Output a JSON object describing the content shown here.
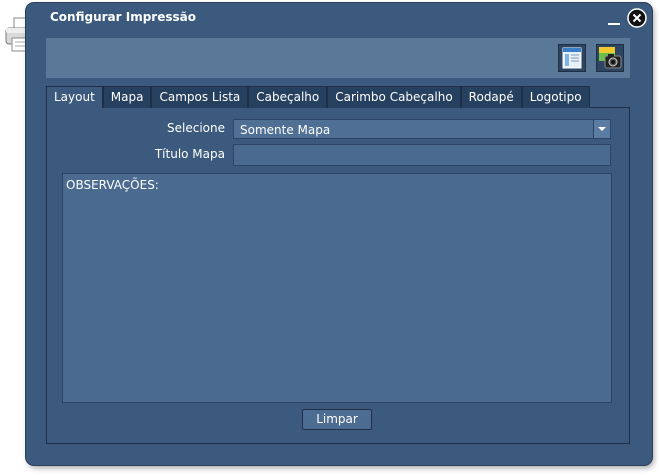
{
  "window": {
    "title": "Configurar Impressão"
  },
  "toolbar": {
    "buttons": [
      {
        "icon": "layout-preview-icon"
      },
      {
        "icon": "camera-snapshot-icon"
      }
    ]
  },
  "tabs": [
    {
      "label": "Layout",
      "active": true
    },
    {
      "label": "Mapa",
      "active": false
    },
    {
      "label": "Campos Lista",
      "active": false
    },
    {
      "label": "Cabeçalho",
      "active": false
    },
    {
      "label": "Carimbo Cabeçalho",
      "active": false
    },
    {
      "label": "Rodapé",
      "active": false
    },
    {
      "label": "Logotipo",
      "active": false
    }
  ],
  "form": {
    "selecione_label": "Selecione",
    "selecione_value": "Somente Mapa",
    "titulo_mapa_label": "Título Mapa",
    "titulo_mapa_value": "",
    "observacoes_text": "OBSERVAÇÕES:"
  },
  "actions": {
    "limpar_label": "Limpar"
  },
  "colors": {
    "window_bg": "#3c5a7e",
    "toolbar_bg": "#5a7898",
    "tab_bg": "#26405f",
    "field_bg": "#4a6a90"
  }
}
